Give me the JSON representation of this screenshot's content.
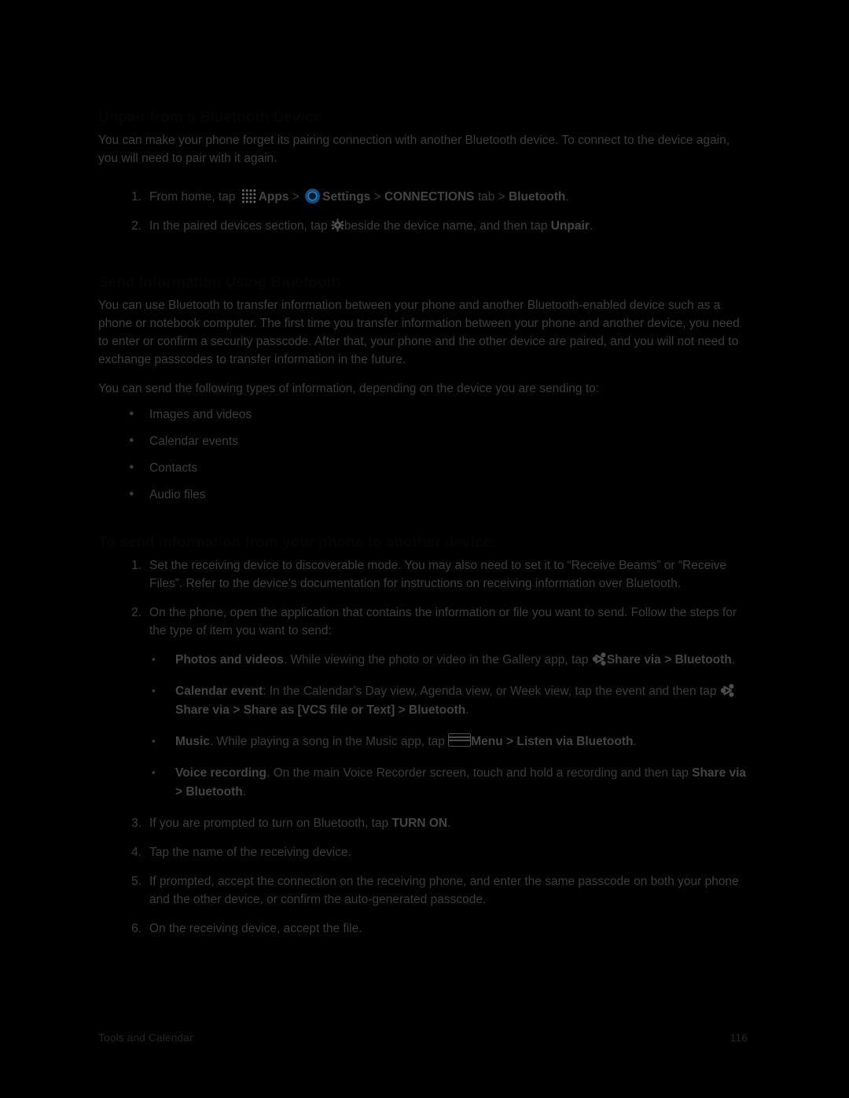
{
  "page": {
    "footer_left": "Tools and Calendar",
    "footer_right": "116"
  },
  "sections": {
    "unpair_heading": "Unpair from a Bluetooth Device",
    "unpair_intro": "You can make your phone forget its pairing connection with another Bluetooth device. To connect to the device again, you will need to pair with it again.",
    "unpair_steps": [
      {
        "num": "1.",
        "parts": [
          {
            "t": "From home, tap "
          },
          {
            "icon": "apps-icon"
          },
          {
            "t": "Apps",
            "b": true
          },
          {
            "t": " > "
          },
          {
            "icon": "settings-icon"
          },
          {
            "t": "Settings",
            "b": true
          },
          {
            "t": " > "
          },
          {
            "t": "CONNECTIONS",
            "b": true
          },
          {
            "t": " tab > "
          },
          {
            "t": "Bluetooth",
            "b": true
          },
          {
            "t": "."
          }
        ]
      },
      {
        "num": "2.",
        "parts": [
          {
            "t": "In the paired devices section, tap "
          },
          {
            "icon": "gear-icon"
          },
          {
            "t": "beside the device name, and then tap "
          },
          {
            "t": "Unpair",
            "b": true
          },
          {
            "t": "."
          }
        ]
      }
    ],
    "send_heading": "Send Information Using Bluetooth",
    "send_intro_1": "You can use Bluetooth to transfer information between your phone and another Bluetooth-enabled device such as a phone or notebook computer. The first time you transfer information between your phone and another device, you need to enter or confirm a security passcode. After that, your phone and the other device are paired, and you will not need to exchange passcodes to transfer information in the future.",
    "send_intro_2": "You can send the following types of information, depending on the device you are sending to:",
    "types": [
      "Images and videos",
      "Calendar events",
      "Contacts",
      "Audio files"
    ],
    "send_sub_heading": "To send information from your phone to another device:",
    "send_steps": [
      {
        "num": "1.",
        "text": "Set the receiving device to discoverable mode. You may also need to set it to “Receive Beams” or “Receive Files”. Refer to the device’s documentation for instructions on receiving information over Bluetooth."
      },
      {
        "num": "2.",
        "text": "On the phone, open the application that contains the information or file you want to send. Follow the steps for the type of item you want to send:"
      },
      {
        "num": "3.",
        "parts": [
          {
            "t": "If you are prompted to turn on Bluetooth, tap "
          },
          {
            "t": "TURN ON",
            "b": true
          },
          {
            "t": "."
          }
        ]
      },
      {
        "num": "4.",
        "text": "Tap the name of the receiving device."
      },
      {
        "num": "5.",
        "text": "If prompted, accept the connection on the receiving phone, and enter the same passcode on both your phone and the other device, or confirm the auto-generated passcode."
      },
      {
        "num": "6.",
        "text": "On the receiving device, accept the file."
      }
    ],
    "item_types": [
      {
        "parts": [
          {
            "t": "Photos and videos",
            "b": true
          },
          {
            "t": ". While viewing the photo or video in the Gallery app, tap "
          },
          {
            "icon": "share-icon"
          },
          {
            "t": "Share via",
            "b": true
          },
          {
            "t": " > ",
            "b": true
          },
          {
            "t": "Bluetooth",
            "b": true
          },
          {
            "t": "."
          }
        ]
      },
      {
        "parts": [
          {
            "t": "Calendar event",
            "b": true
          },
          {
            "t": ": In the Calendar’s Day view, Agenda view, or Week view, tap the event and then tap "
          },
          {
            "icon": "share-icon"
          },
          {
            "t": "Share via > Share as [VCS file or Text] > Bluetooth",
            "b": true
          },
          {
            "t": "."
          }
        ]
      },
      {
        "parts": [
          {
            "t": "Music",
            "b": true
          },
          {
            "t": ". While playing a song in the Music app, tap "
          },
          {
            "icon": "menu-icon"
          },
          {
            "t": "Menu > Listen via Bluetooth",
            "b": true
          },
          {
            "t": "."
          }
        ]
      },
      {
        "parts": [
          {
            "t": "Voice recording",
            "b": true
          },
          {
            "t": ". On the main Voice Recorder screen, touch and hold a recording and then tap "
          },
          {
            "t": "Share via > Bluetooth",
            "b": true
          },
          {
            "t": "."
          }
        ]
      }
    ]
  }
}
